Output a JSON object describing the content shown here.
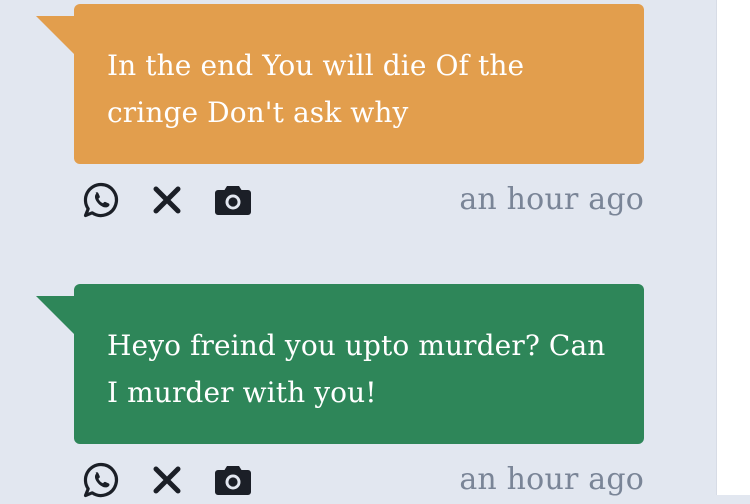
{
  "colors": {
    "page_background": "#e2e7f0",
    "timestamp_text": "#7a8597",
    "icon": "#1b1f27"
  },
  "posts": [
    {
      "message": "In the end You will die Of the cringe Don't ask why",
      "bubble_color": "#e29e4d",
      "timestamp": "an hour ago",
      "actions": [
        "whatsapp-icon",
        "close-icon",
        "camera-icon"
      ]
    },
    {
      "message": "Heyo freind you upto murder? Can I murder with you!",
      "bubble_color": "#2e8659",
      "timestamp": "an hour ago",
      "actions": [
        "whatsapp-icon",
        "close-icon",
        "camera-icon"
      ]
    }
  ]
}
